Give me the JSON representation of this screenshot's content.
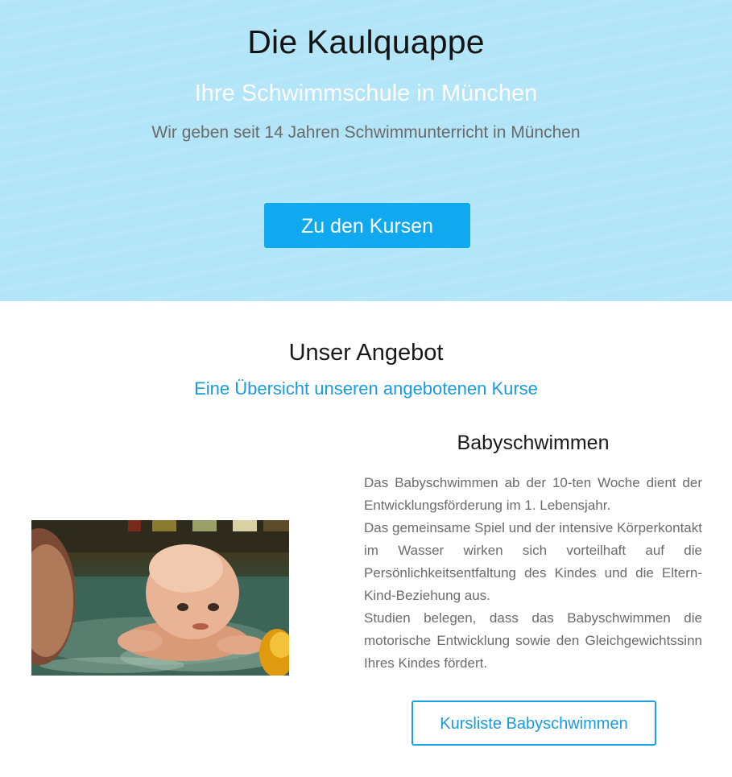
{
  "hero": {
    "title": "Die Kaulquappe",
    "subtitle": "Ihre Schwimmschule in München",
    "tagline": "Wir geben seit 14 Jahren Schwimmunterricht in München",
    "button_label": "Zu den Kursen",
    "background_color": "#b3e5f8",
    "button_color": "#10a8ef"
  },
  "offer": {
    "title": "Unser Angebot",
    "subtitle": "Eine Übersicht unseren angebotenen Kurse",
    "accent_color": "#1a9be0"
  },
  "courses": [
    {
      "title": "Babyschwimmen",
      "image_icon": "baby-swimming-photo",
      "description": [
        "Das Babyschwimmen ab der 10-ten Woche dient der Entwicklungsförderung im 1. Lebensjahr.",
        "Das gemeinsame Spiel und der intensive Körperkontakt im Wasser wirken sich vorteilhaft auf die Persönlichkeitsentfaltung des Kindes und die Eltern-Kind-Beziehung aus.",
        "Studien belegen, dass das Babyschwimmen die motorische Entwicklung sowie den Gleichgewichtssinn Ihres Kindes fördert."
      ],
      "button_label": "Kursliste Babyschwimmen"
    }
  ]
}
